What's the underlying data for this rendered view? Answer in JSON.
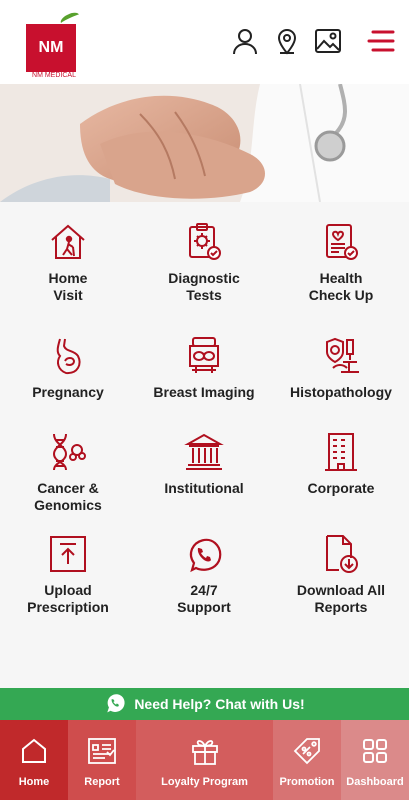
{
  "app": {
    "logo_text": "NM",
    "logo_subtext": "NM MEDICAL"
  },
  "header": {
    "icons": [
      "user-icon",
      "location-pin-icon",
      "gallery-icon",
      "menu-icon"
    ]
  },
  "services": [
    {
      "label": "Home\nVisit",
      "icon": "home-visit-icon"
    },
    {
      "label": "Diagnostic\nTests",
      "icon": "diagnostic-clipboard-icon"
    },
    {
      "label": "Health\nCheck Up",
      "icon": "health-report-icon"
    },
    {
      "label": "Pregnancy",
      "icon": "pregnancy-icon"
    },
    {
      "label": "Breast Imaging",
      "icon": "imaging-machine-icon"
    },
    {
      "label": "Histopathology",
      "icon": "microscope-icon"
    },
    {
      "label": "Cancer &\nGenomics",
      "icon": "dna-icon"
    },
    {
      "label": "Institutional",
      "icon": "institution-building-icon"
    },
    {
      "label": "Corporate",
      "icon": "office-building-icon"
    },
    {
      "label": "Upload\nPrescription",
      "icon": "upload-icon"
    },
    {
      "label": "24/7\nSupport",
      "icon": "whatsapp-icon"
    },
    {
      "label": "Download All\nReports",
      "icon": "download-file-icon"
    }
  ],
  "help_bar": {
    "label": "Need Help? Chat with Us!",
    "icon": "whatsapp-icon"
  },
  "bottom_nav": [
    {
      "label": "Home",
      "icon": "home-icon",
      "active": true
    },
    {
      "label": "Report",
      "icon": "report-icon"
    },
    {
      "label": "Loyalty Program",
      "icon": "gift-icon"
    },
    {
      "label": "Promotion",
      "icon": "promotion-tag-icon"
    },
    {
      "label": "Dashboard",
      "icon": "dashboard-grid-icon"
    }
  ],
  "colors": {
    "brand_red": "#c8102e",
    "icon_red": "#b0101f",
    "help_green": "#34a853",
    "nav_home": "#c0292b",
    "nav_report": "#cf4d4d",
    "nav_loyalty": "#d35d5d",
    "nav_promotion": "#d77373",
    "nav_dashboard": "#db8a8a"
  }
}
